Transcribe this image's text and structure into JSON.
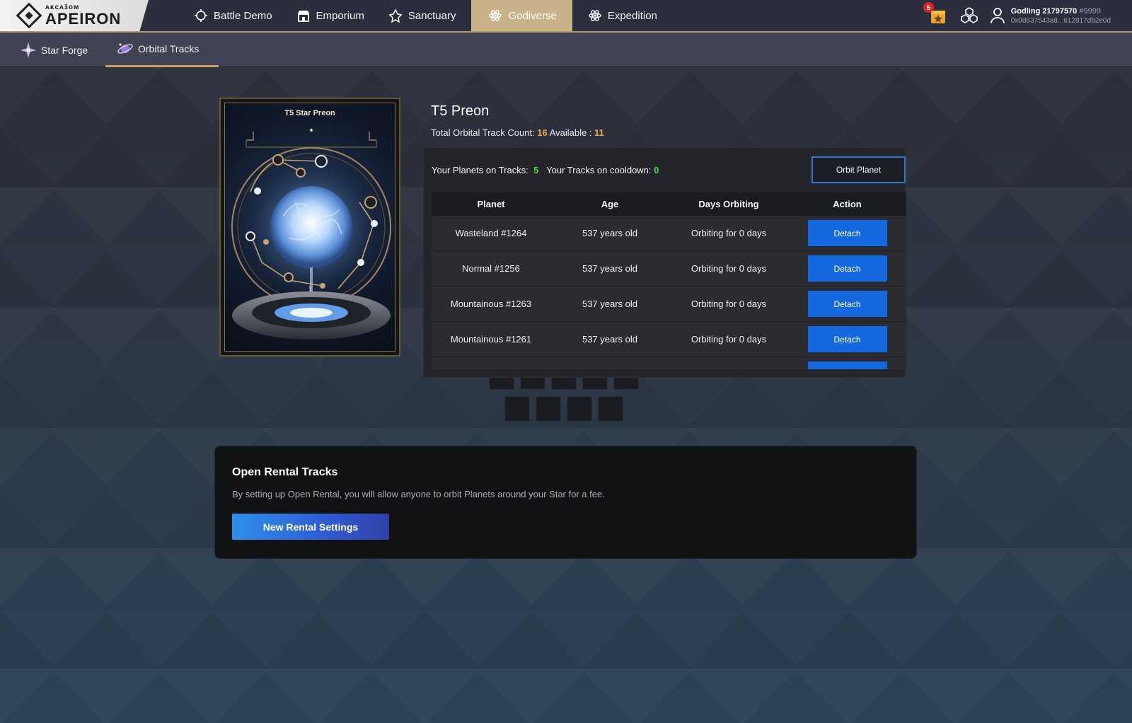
{
  "brand": {
    "subtitle": "ᴀᴋᴄᴀɜ̃ᴏᴍ",
    "name": "APEIRON"
  },
  "nav": {
    "items": [
      {
        "label": "Battle Demo",
        "icon": "battle-icon"
      },
      {
        "label": "Emporium",
        "icon": "shop-icon"
      },
      {
        "label": "Sanctuary",
        "icon": "sanctuary-icon"
      },
      {
        "label": "Godiverse",
        "icon": "atom-icon",
        "active": true
      },
      {
        "label": "Expedition",
        "icon": "atom-icon"
      }
    ]
  },
  "header": {
    "notification_count": "5",
    "user": {
      "name": "Godling 21797570",
      "tag": "#9999",
      "address": "0x0d637543a8...612817db2e0d"
    }
  },
  "subnav": {
    "tabs": [
      {
        "label": "Star Forge",
        "icon": "star-forge-icon"
      },
      {
        "label": "Orbital Tracks",
        "icon": "orbital-icon",
        "active": true
      }
    ]
  },
  "card": {
    "title": "T5 Star Preon"
  },
  "star": {
    "name": "T5 Preon",
    "count_label": "Total Orbital Track Count:",
    "count_value": "16",
    "available_label": "Available :",
    "available_value": "11"
  },
  "tracks": {
    "planets_label": "Your Planets on Tracks:",
    "planets_value": "5",
    "cooldown_label": "Your Tracks on cooldown:",
    "cooldown_value": "0",
    "orbit_button": "Orbit Planet",
    "columns": [
      "Planet",
      "Age",
      "Days Orbiting",
      "Action"
    ],
    "rows": [
      {
        "planet": "Wasteland #1264",
        "age": "537 years old",
        "days": "Orbiting for 0 days",
        "action": "Detach"
      },
      {
        "planet": "Normal #1256",
        "age": "537 years old",
        "days": "Orbiting for 0 days",
        "action": "Detach"
      },
      {
        "planet": "Mountainous #1263",
        "age": "537 years old",
        "days": "Orbiting for 0 days",
        "action": "Detach"
      },
      {
        "planet": "Mountainous #1261",
        "age": "537 years old",
        "days": "Orbiting for 0 days",
        "action": "Detach"
      },
      {
        "planet": "",
        "age": "",
        "days": "",
        "action": ""
      }
    ]
  },
  "rental": {
    "title": "Open Rental Tracks",
    "description": "By setting up Open Rental, you will allow anyone to orbit Planets around your Star for a fee.",
    "button": "New Rental Settings"
  },
  "colors": {
    "accent_gold": "#c9b28a",
    "button_blue": "#1468e0",
    "highlight_orange": "#f0a63a",
    "highlight_green": "#5bd35b"
  }
}
